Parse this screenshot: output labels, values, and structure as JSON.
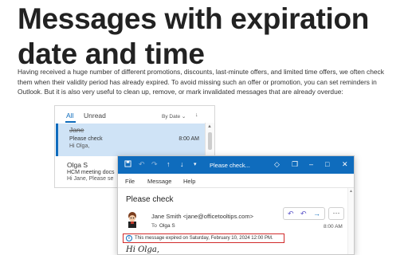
{
  "article": {
    "title": "Messages with expiration date and time",
    "intro": "Having received a huge number of different promotions, discounts, last-minute offers, and limited time offers, we often check them when their validity period has already expired. To avoid missing such an offer or promotion, you can set reminders in Outlook. But it is also very useful to clean up, remove, or mark invalidated messages that are already overdue:"
  },
  "inbox": {
    "tabs": [
      "All",
      "Unread"
    ],
    "active_tab": "All",
    "sort_label": "By Date",
    "sort_icon": "arrow-down-icon",
    "messages": [
      {
        "sender": "Jane",
        "subject": "Please check",
        "time": "8:00 AM",
        "preview": "Hi Olga,",
        "expired": true,
        "selected": true
      },
      {
        "sender": "Olga S",
        "subject": "HCM meeting docs",
        "time": "",
        "preview": "Hi Jane,  Please se",
        "expired": false,
        "selected": false
      }
    ]
  },
  "message_window": {
    "toolbar_icons": [
      "save-icon",
      "undo-icon",
      "redo-icon",
      "up-arrow-icon",
      "down-arrow-icon"
    ],
    "window_title": "Please check...",
    "title_icons": [
      "gem-icon",
      "restore-icon",
      "minimize-icon",
      "maximize-icon",
      "close-icon"
    ],
    "ribbon_tabs": [
      "File",
      "Message",
      "Help"
    ],
    "subject": "Please check",
    "from": "Jane Smith <jane@officetooltips.com>",
    "to_label": "To",
    "to_value": "Olga S",
    "time": "8:00 AM",
    "expired_notice": "This message expired on Saturday, February 10, 2024 12:00 PM.",
    "body_start": "Hi Olga,",
    "actions": [
      "reply-icon",
      "reply-all-icon",
      "forward-icon",
      "more-icon"
    ]
  },
  "colors": {
    "accent": "#0f6cbd",
    "selected_bg": "#cfe3f6",
    "highlight_border": "#d12a2a"
  }
}
